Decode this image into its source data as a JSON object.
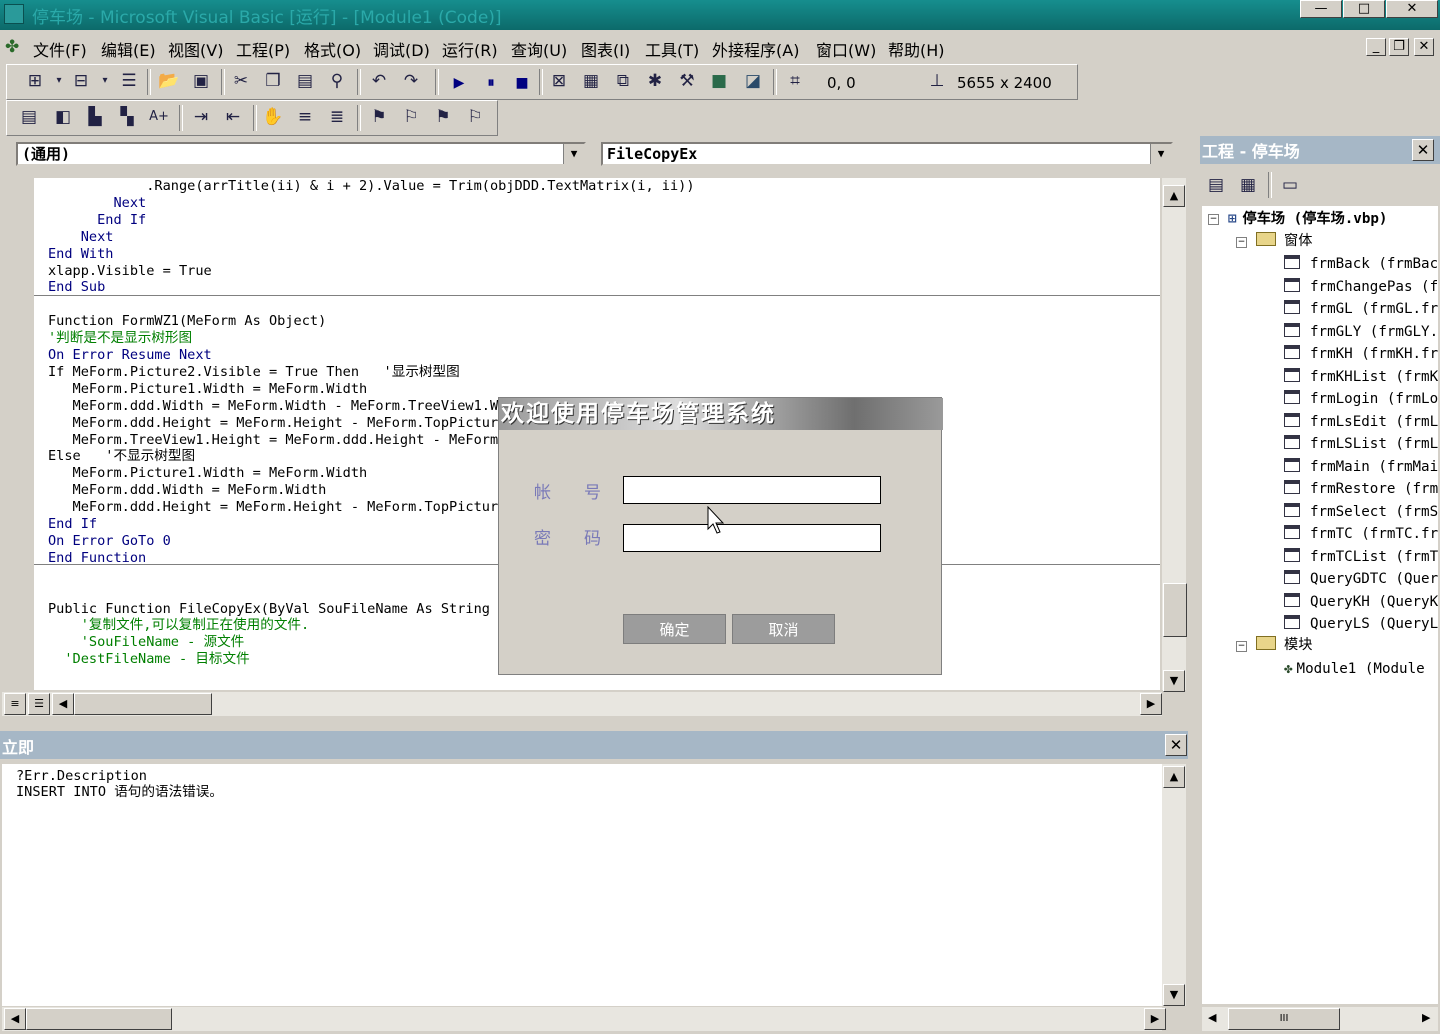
{
  "window": {
    "title": "停车场 - Microsoft Visual Basic [运行] - [Module1 (Code)]",
    "min": "—",
    "max": "□",
    "close": "✕"
  },
  "menu": [
    "文件(F)",
    "编辑(E)",
    "视图(V)",
    "工程(P)",
    "格式(O)",
    "调试(D)",
    "运行(R)",
    "查询(U)",
    "图表(I)",
    "工具(T)",
    "外接程序(A)",
    "窗口(W)",
    "帮助(H)"
  ],
  "child_controls": {
    "min": "_",
    "restore": "❐",
    "close": "✕"
  },
  "toolbar": {
    "position": "0, 0",
    "size": "5655 x 2400"
  },
  "code_window": {
    "object_combo": "(通用)",
    "procedure_combo": "FileCopyEx",
    "lines": [
      {
        "text": "            .Range(arrTitle(ii) & i + 2).Value = Trim(objDDD.TextMatrix(i, ii))",
        "cls": ""
      },
      {
        "text": "        Next",
        "cls": "kw"
      },
      {
        "text": "      End If",
        "cls": "kw"
      },
      {
        "text": "    Next",
        "cls": "kw"
      },
      {
        "text": "End With",
        "cls": "kw"
      },
      {
        "text": "xlapp.Visible = True",
        "cls": ""
      },
      {
        "text": "End Sub",
        "cls": "kw"
      },
      {
        "text": "",
        "cls": ""
      },
      {
        "text": "Function FormWZ1(MeForm As Object)",
        "cls": ""
      },
      {
        "text": "'判断是不是显示树形图",
        "cls": "cm"
      },
      {
        "text": "On Error Resume Next",
        "cls": "kw"
      },
      {
        "text": "If MeForm.Picture2.Visible = True Then   '显示树型图",
        "cls": ""
      },
      {
        "text": "   MeForm.Picture1.Width = MeForm.Width",
        "cls": ""
      },
      {
        "text": "   MeForm.ddd.Width = MeForm.Width - MeForm.TreeView1.Width",
        "cls": ""
      },
      {
        "text": "   MeForm.ddd.Height = MeForm.Height - MeForm.TopPicture.Height",
        "cls": ""
      },
      {
        "text": "   MeForm.TreeView1.Height = MeForm.ddd.Height - MeForm",
        "cls": ""
      },
      {
        "text": "Else   '不显示树型图",
        "cls": ""
      },
      {
        "text": "   MeForm.Picture1.Width = MeForm.Width",
        "cls": ""
      },
      {
        "text": "   MeForm.ddd.Width = MeForm.Width",
        "cls": ""
      },
      {
        "text": "   MeForm.ddd.Height = MeForm.Height - MeForm.TopPicture.Height",
        "cls": ""
      },
      {
        "text": "End If",
        "cls": "kw"
      },
      {
        "text": "On Error GoTo 0",
        "cls": "kw"
      },
      {
        "text": "End Function",
        "cls": "kw"
      },
      {
        "text": "",
        "cls": ""
      },
      {
        "text": "",
        "cls": ""
      },
      {
        "text": "Public Function FileCopyEx(ByVal SouFileName As String",
        "cls": ""
      },
      {
        "text": "    '复制文件,可以复制正在使用的文件.",
        "cls": "cm"
      },
      {
        "text": "    'SouFileName - 源文件",
        "cls": "cm"
      },
      {
        "text": "  'DestFileName - 目标文件",
        "cls": "cm"
      }
    ]
  },
  "login_dialog": {
    "title": "欢迎使用停车场管理系统",
    "account_label": "帐号",
    "password_label": "密码",
    "account_value": "",
    "password_value": "",
    "ok_button": "确定",
    "cancel_button": "取消"
  },
  "immediate": {
    "title": "立即",
    "close": "✕",
    "lines": [
      "?Err.Description",
      "INSERT INTO 语句的语法错误。"
    ]
  },
  "project": {
    "title": "工程 - 停车场",
    "close": "✕",
    "root": "停车场 (停车场.vbp)",
    "forms_folder": "窗体",
    "forms": [
      "frmBack (frmBac",
      "frmChangePas (f",
      "frmGL (frmGL.fr",
      "frmGLY (frmGLY.",
      "frmKH (frmKH.fr",
      "frmKHList (frmK",
      "frmLogin (frmLo",
      "frmLsEdit (frmL",
      "frmLSList (frmL",
      "frmMain (frmMai",
      "frmRestore (frm",
      "frmSelect (frmS",
      "frmTC (frmTC.fr",
      "frmTCList (frmT",
      "QueryGDTC (Quer",
      "QueryKH (QueryK",
      "QueryLS (QueryL"
    ],
    "modules_folder": "模块",
    "modules": [
      "Module1 (Module"
    ]
  },
  "hscroll_grip": "III"
}
